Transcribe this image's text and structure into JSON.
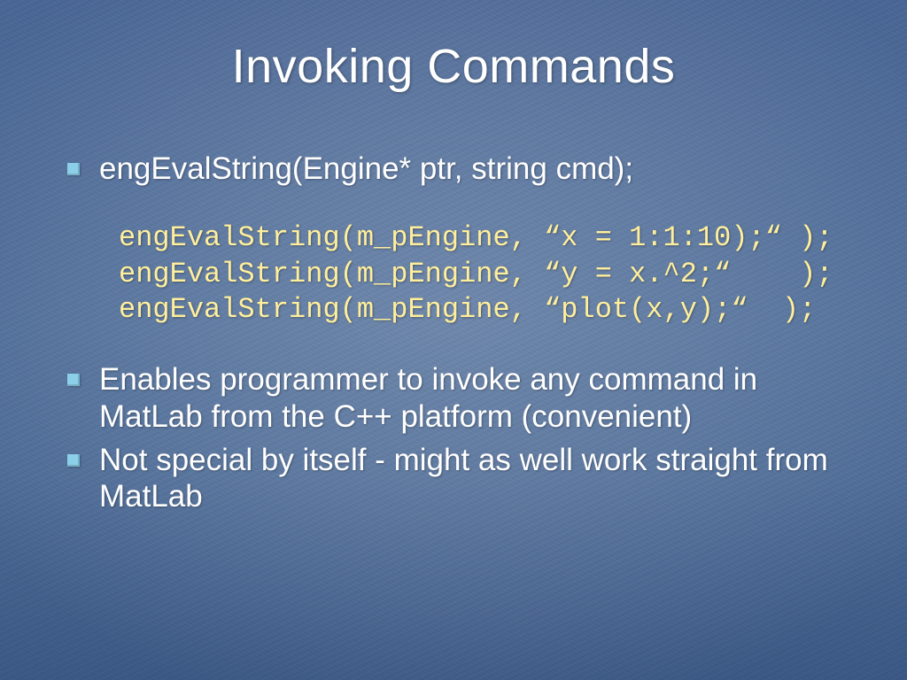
{
  "title": "Invoking Commands",
  "bullets": {
    "b1": "engEvalString(Engine* ptr, string cmd);",
    "b2": "Enables programmer to invoke any command in MatLab from the C++ platform (convenient)",
    "b3": "Not special by itself - might as well work straight from MatLab"
  },
  "code": {
    "line1": "engEvalString(m_pEngine, “x = 1:1:10);“ );",
    "line2": "engEvalString(m_pEngine, “y = x.^2;“    );",
    "line3": "engEvalString(m_pEngine, “plot(x,y);“  );"
  }
}
